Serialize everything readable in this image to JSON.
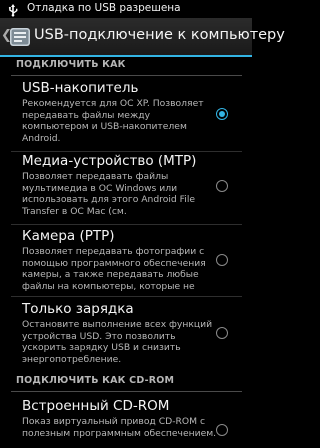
{
  "status_bar": {
    "notification": "Отладка по USB разрешена",
    "icon": "usb-debug-icon"
  },
  "action_bar": {
    "title": "USB-подключение к компьютеру",
    "icon": "settings-app-icon"
  },
  "sections": [
    {
      "header": "ПОДКЛЮЧИТЬ КАК",
      "options": [
        {
          "title": "USB-накопитель",
          "summary": "Рекомендуется для ОС XP. Позволяет передавать файлы между компьютером и USB-накопителем Android.",
          "checked": true
        },
        {
          "title": "Медиа-устройство (MTP)",
          "summary": "Позволяет передавать файлы мультимедиа в ОС Windows или использовать для этого Android File Transfer в ОС Mac (см.",
          "checked": false
        },
        {
          "title": "Камера (PTP)",
          "summary": "Позволяет передавать фотографии с помощью программного обеспечения камеры, а также передавать любые файлы на компьютеры, которые не",
          "checked": false
        },
        {
          "title": "Только зарядка",
          "summary": "Остановите выполнение всех функций устройства USD. Это позволить ускорить зарядку USB и снизить энергопотребление.",
          "checked": false
        }
      ]
    },
    {
      "header": "ПОДКЛЮЧИТЬ КАК CD-ROM",
      "options": [
        {
          "title": "Встроенный CD-ROM",
          "summary": "Показ виртуальный привод CD-ROM с полезным программным обеспечением.",
          "checked": false
        }
      ]
    }
  ],
  "colors": {
    "accent": "#33b5e5",
    "background": "#000000"
  }
}
